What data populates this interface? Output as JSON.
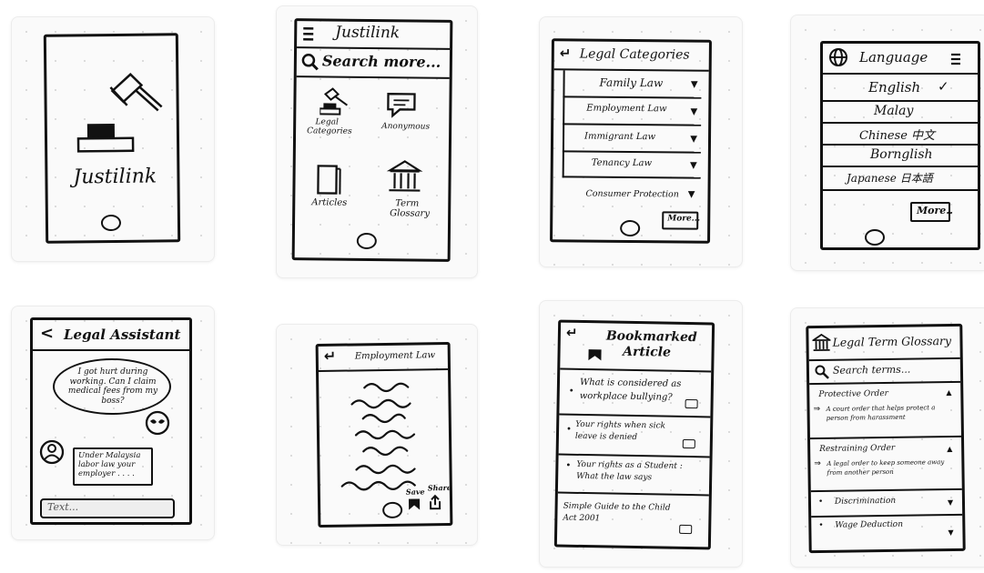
{
  "screens": {
    "splash": {
      "app_name": "Justilink"
    },
    "home": {
      "header_title": "Justilink",
      "search_placeholder": "Search more...",
      "menu": {
        "legal_categories": "Legal Categories",
        "anonymous": "Anonymous",
        "articles": "Articles",
        "term_glossary": "Term Glossary"
      }
    },
    "categories": {
      "title": "Legal Categories",
      "items": [
        "Family Law",
        "Employment Law",
        "Immigrant Law",
        "Tenancy Law",
        "Consumer Protection"
      ],
      "more_button": "More..."
    },
    "language": {
      "title": "Language",
      "options": [
        "English",
        "Malay",
        "Chinese 中文",
        "Bornglish",
        "Japanese 日本語"
      ],
      "selected_mark": "✓",
      "more_button": "More.."
    },
    "assistant": {
      "title": "Legal Assistant",
      "back_icon": "<",
      "user_message": "I got hurt during working. Can I claim medical fees from my boss?",
      "bot_reply": "Under Malaysia labor law your employer . . . .",
      "input_placeholder": "Text..."
    },
    "article": {
      "title": "Employment Law",
      "save_label": "Save",
      "share_label": "Share"
    },
    "bookmarks": {
      "title": "Bookmarked Article",
      "items": [
        "What is considered as workplace bullying?",
        "Your rights when sick leave is denied",
        "Your rights as a Student : What the law says",
        "Simple Guide to the Child Act 2001"
      ]
    },
    "glossary": {
      "title": "Legal Term Glossary",
      "search_placeholder": "Search terms...",
      "terms": [
        {
          "term": "Protective Order",
          "definition": "A court order that helps protect a person from harassment"
        },
        {
          "term": "Restraining Order",
          "definition": "A legal order to keep someone away from another person"
        },
        {
          "term": "Discrimination",
          "definition": ""
        },
        {
          "term": "Wage Deduction",
          "definition": ""
        }
      ]
    }
  }
}
